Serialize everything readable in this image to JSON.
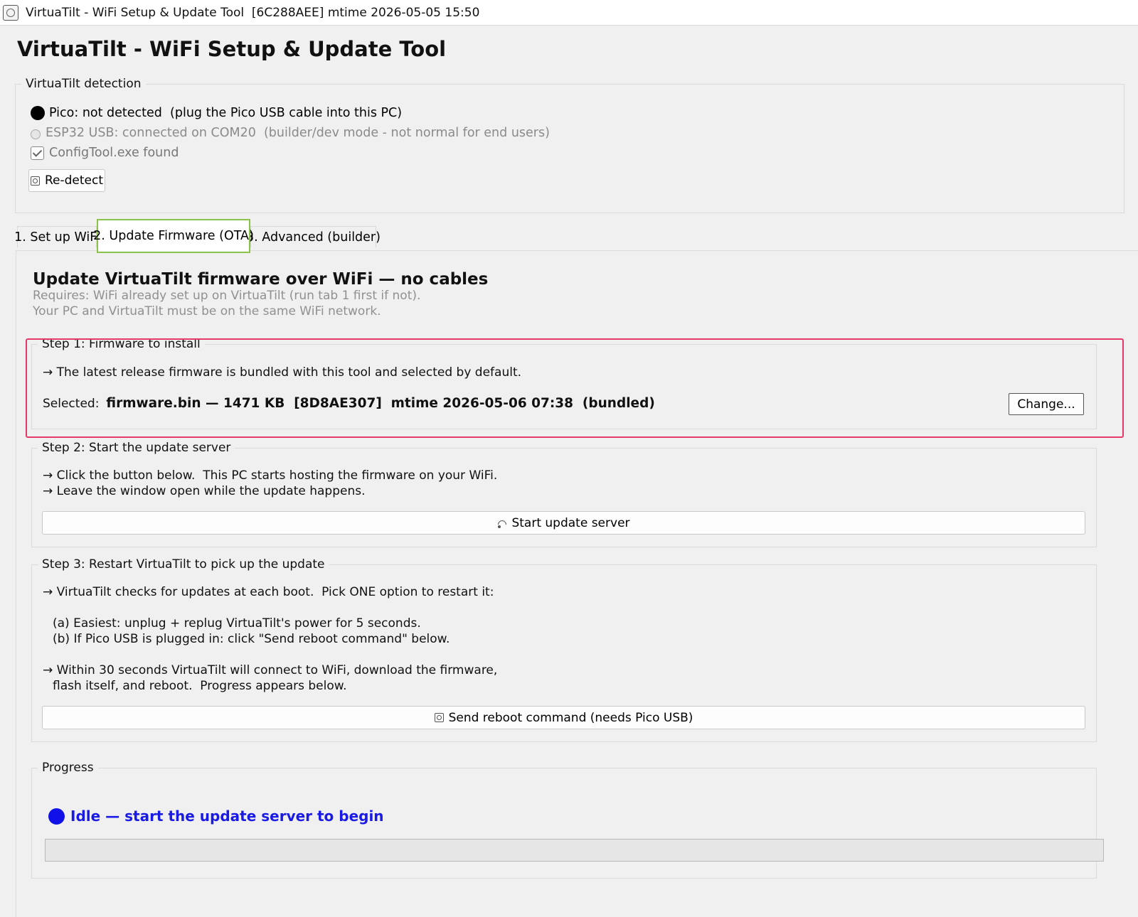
{
  "window": {
    "title": "VirtuaTilt - WiFi Setup & Update Tool  [6C288AEE] mtime 2026-05-05 15:50"
  },
  "app_heading": "VirtuaTilt - WiFi Setup & Update Tool",
  "detection": {
    "legend": "VirtuaTilt detection",
    "pico_status": "Pico: not detected  (plug the Pico USB cable into this PC)",
    "esp32_status": "ESP32 USB: connected on COM20  (builder/dev mode - not normal for end users)",
    "configtool_status": "ConfigTool.exe found",
    "redetect_label": "Re-detect"
  },
  "tabs": [
    {
      "label": "1. Set up WiFi",
      "active": false
    },
    {
      "label": "2. Update Firmware (OTA)",
      "active": true
    },
    {
      "label": "3. Advanced (builder)",
      "active": false
    }
  ],
  "ota": {
    "heading": "Update VirtuaTilt firmware over WiFi — no cables",
    "requires_line1": "Requires: WiFi already set up on VirtuaTilt (run tab 1 first if not).",
    "requires_line2": "Your PC and VirtuaTilt must be on the same WiFi network.",
    "step1": {
      "legend": "Step 1: Firmware to install",
      "info": "→ The latest release firmware is bundled with this tool and selected by default.",
      "selected_label": "Selected:",
      "selected_value": "firmware.bin — 1471 KB  [8D8AE307]  mtime 2026-05-06 07:38  (bundled)",
      "change_label": "Change..."
    },
    "step2": {
      "legend": "Step 2: Start the update server",
      "line1": "→ Click the button below.  This PC starts hosting the firmware on your WiFi.",
      "line2": "→ Leave the window open while the update happens.",
      "button_label": "Start update server"
    },
    "step3": {
      "legend": "Step 3: Restart VirtuaTilt to pick up the update",
      "line1": "→ VirtuaTilt checks for updates at each boot.  Pick ONE option to restart it:",
      "option_a": "(a) Easiest: unplug + replug VirtuaTilt's power for 5 seconds.",
      "option_b": "(b) If Pico USB is plugged in: click \"Send reboot command\" below.",
      "line2": "→ Within 30 seconds VirtuaTilt will connect to WiFi, download the firmware,",
      "line3": "flash itself, and reboot.  Progress appears below.",
      "button_label": "Send reboot command (needs Pico USB)"
    },
    "progress": {
      "legend": "Progress",
      "status": "Idle — start the update server to begin",
      "status_color": "#1a1ae6",
      "percent": 0
    }
  },
  "colors": {
    "highlight_tab": "#8bc34a",
    "highlight_step1": "#e5396a"
  }
}
